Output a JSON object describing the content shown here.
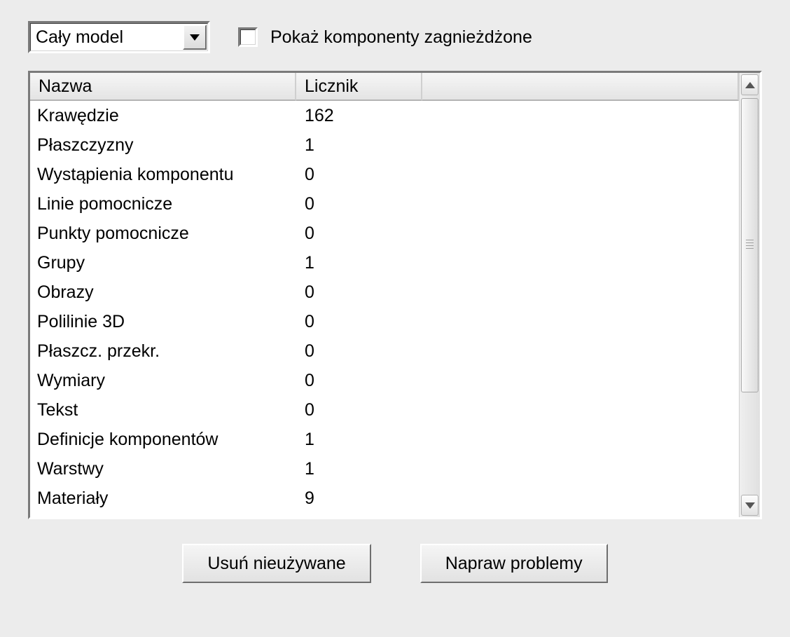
{
  "dropdown": {
    "selected": "Cały model"
  },
  "checkbox": {
    "label": "Pokaż komponenty zagnieżdżone",
    "checked": false
  },
  "table": {
    "columns": [
      "Nazwa",
      "Licznik",
      ""
    ],
    "rows": [
      {
        "name": "Krawędzie",
        "count": "162"
      },
      {
        "name": "Płaszczyzny",
        "count": "1"
      },
      {
        "name": "Wystąpienia komponentu",
        "count": "0"
      },
      {
        "name": "Linie pomocnicze",
        "count": "0"
      },
      {
        "name": "Punkty pomocnicze",
        "count": "0"
      },
      {
        "name": "Grupy",
        "count": "1"
      },
      {
        "name": "Obrazy",
        "count": "0"
      },
      {
        "name": "Polilinie 3D",
        "count": "0"
      },
      {
        "name": "Płaszcz. przekr.",
        "count": "0"
      },
      {
        "name": "Wymiary",
        "count": "0"
      },
      {
        "name": "Tekst",
        "count": "0"
      },
      {
        "name": "Definicje komponentów",
        "count": "1"
      },
      {
        "name": "Warstwy",
        "count": "1"
      },
      {
        "name": "Materiały",
        "count": "9"
      }
    ]
  },
  "buttons": {
    "purge": "Usuń nieużywane",
    "fix": "Napraw problemy"
  }
}
